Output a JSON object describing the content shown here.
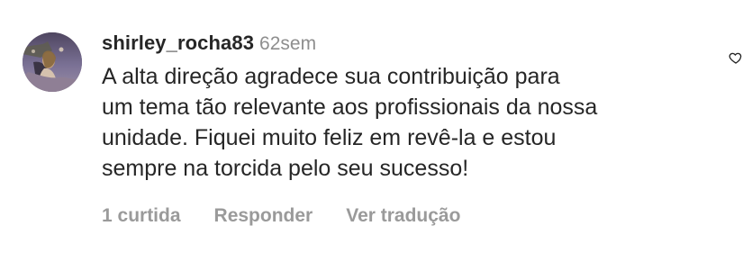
{
  "comment": {
    "username": "shirley_rocha83",
    "timestamp": "62sem",
    "text": "A alta direção agradece sua contribuição para\num tema tão relevante aos profissionais da nossa\nunidade.  Fiquei muito feliz em revê-la e estou\nsempre na torcida pelo seu sucesso!",
    "actions": {
      "likes": "1 curtida",
      "reply": "Responder",
      "translate": "Ver tradução"
    },
    "icons": {
      "avatar": "user-avatar",
      "like": "heart-icon"
    },
    "colors": {
      "text": "#262626",
      "muted": "#8e8e8e"
    }
  }
}
